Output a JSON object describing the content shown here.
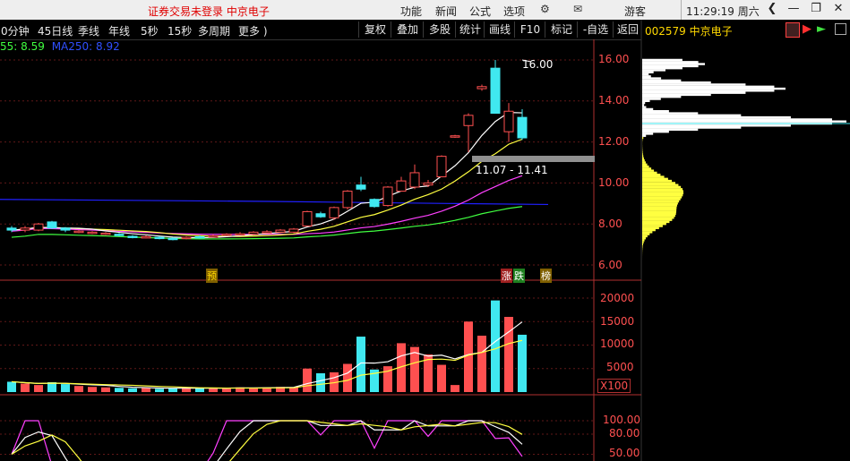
{
  "titlebar": {
    "warning": "证券交易未登录  中京电子",
    "menus": [
      "功能",
      "新闻",
      "公式",
      "选项"
    ],
    "guest": "游客",
    "clock": "11:29:19 周六"
  },
  "toolbar": {
    "periods": [
      "0分钟",
      "45日线",
      "季线",
      "年线",
      "5秒",
      "15秒",
      "多周期",
      "更多 )"
    ],
    "buttons": [
      "复权",
      "叠加",
      "多股",
      "统计",
      "画线",
      "F10",
      "标记",
      "-自选",
      "返回"
    ]
  },
  "ma_legend": {
    "ma_part1": "55: 8.59",
    "ma_part2": "MA250: 8.92"
  },
  "stock": {
    "code_name": "002579 中京电子"
  },
  "price_axis": [
    "16.00",
    "14.00",
    "12.00",
    "10.00",
    "8.00",
    "6.00"
  ],
  "volume_axis": [
    "20000",
    "15000",
    "10000",
    "5000"
  ],
  "volume_unit": "X100",
  "ind_axis": [
    "100.00",
    "80.00",
    "50.00"
  ],
  "annotations": {
    "high": "16.00",
    "band": "11.07 - 11.41",
    "pre": "预",
    "zhang": "涨",
    "die": "跌",
    "bang": "榜"
  },
  "colors": {
    "up": "#ff5050",
    "down": "#40e8f0",
    "ma_white": "#ffffff",
    "ma_yellow": "#ffff40",
    "ma_magenta": "#ff40ff",
    "ma_green": "#40ff40",
    "ma_blue": "#2020ff"
  },
  "chart_data": {
    "type": "candlestick",
    "price_ylim": [
      5.5,
      16.6
    ],
    "candles": [
      {
        "o": 7.8,
        "c": 7.7,
        "h": 7.9,
        "l": 7.6
      },
      {
        "o": 7.7,
        "c": 7.8,
        "h": 7.9,
        "l": 7.6
      },
      {
        "o": 7.7,
        "c": 8.0,
        "h": 8.05,
        "l": 7.65
      },
      {
        "o": 8.1,
        "c": 7.8,
        "h": 8.15,
        "l": 7.75
      },
      {
        "o": 7.8,
        "c": 7.7,
        "h": 7.85,
        "l": 7.6
      },
      {
        "o": 7.6,
        "c": 7.65,
        "h": 7.7,
        "l": 7.55
      },
      {
        "o": 7.55,
        "c": 7.6,
        "h": 7.65,
        "l": 7.5
      },
      {
        "o": 7.5,
        "c": 7.55,
        "h": 7.6,
        "l": 7.45
      },
      {
        "o": 7.5,
        "c": 7.45,
        "h": 7.55,
        "l": 7.4
      },
      {
        "o": 7.4,
        "c": 7.38,
        "h": 7.45,
        "l": 7.3
      },
      {
        "o": 7.35,
        "c": 7.38,
        "h": 7.45,
        "l": 7.3
      },
      {
        "o": 7.35,
        "c": 7.3,
        "h": 7.4,
        "l": 7.25
      },
      {
        "o": 7.3,
        "c": 7.28,
        "h": 7.35,
        "l": 7.2
      },
      {
        "o": 7.3,
        "c": 7.35,
        "h": 7.4,
        "l": 7.25
      },
      {
        "o": 7.38,
        "c": 7.35,
        "h": 7.45,
        "l": 7.3
      },
      {
        "o": 7.4,
        "c": 7.42,
        "h": 7.5,
        "l": 7.35
      },
      {
        "o": 7.45,
        "c": 7.5,
        "h": 7.55,
        "l": 7.4
      },
      {
        "o": 7.5,
        "c": 7.52,
        "h": 7.6,
        "l": 7.45
      },
      {
        "o": 7.5,
        "c": 7.6,
        "h": 7.65,
        "l": 7.45
      },
      {
        "o": 7.6,
        "c": 7.62,
        "h": 7.7,
        "l": 7.55
      },
      {
        "o": 7.6,
        "c": 7.7,
        "h": 7.75,
        "l": 7.55
      },
      {
        "o": 7.6,
        "c": 7.75,
        "h": 7.8,
        "l": 7.55
      },
      {
        "o": 7.9,
        "c": 8.6,
        "h": 8.65,
        "l": 7.9
      },
      {
        "o": 8.5,
        "c": 8.35,
        "h": 8.6,
        "l": 8.3
      },
      {
        "o": 8.3,
        "c": 8.8,
        "h": 8.85,
        "l": 8.2
      },
      {
        "o": 8.8,
        "c": 9.6,
        "h": 9.65,
        "l": 8.7
      },
      {
        "o": 9.9,
        "c": 9.7,
        "h": 10.3,
        "l": 9.6
      },
      {
        "o": 9.2,
        "c": 8.85,
        "h": 9.25,
        "l": 8.8
      },
      {
        "o": 8.9,
        "c": 9.8,
        "h": 9.85,
        "l": 8.85
      },
      {
        "o": 9.6,
        "c": 10.1,
        "h": 10.3,
        "l": 9.6
      },
      {
        "o": 9.8,
        "c": 10.5,
        "h": 10.9,
        "l": 9.7
      },
      {
        "o": 9.9,
        "c": 10.0,
        "h": 10.15,
        "l": 9.8
      },
      {
        "o": 10.3,
        "c": 11.3,
        "h": 11.35,
        "l": 10.3
      },
      {
        "o": 12.25,
        "c": 12.3,
        "h": 12.35,
        "l": 12.2
      },
      {
        "o": 12.8,
        "c": 13.3,
        "h": 13.4,
        "l": 11.5
      },
      {
        "o": 14.6,
        "c": 14.7,
        "h": 14.8,
        "l": 14.5
      },
      {
        "o": 15.6,
        "c": 13.4,
        "h": 16.0,
        "l": 13.4
      },
      {
        "o": 12.5,
        "c": 13.5,
        "h": 13.9,
        "l": 12.0
      },
      {
        "o": 13.2,
        "c": 12.2,
        "h": 13.6,
        "l": 12.1
      }
    ],
    "volume_ylim": [
      0,
      21000
    ],
    "volumes": [
      2200,
      1800,
      1500,
      2100,
      1700,
      1300,
      1100,
      1000,
      900,
      800,
      900,
      700,
      800,
      900,
      800,
      900,
      800,
      1000,
      900,
      1000,
      1100,
      1000,
      5000,
      4000,
      4200,
      6000,
      11800,
      4800,
      5500,
      10400,
      9600,
      8000,
      5800,
      1500,
      15000,
      12000,
      19500,
      16000,
      12200
    ]
  }
}
